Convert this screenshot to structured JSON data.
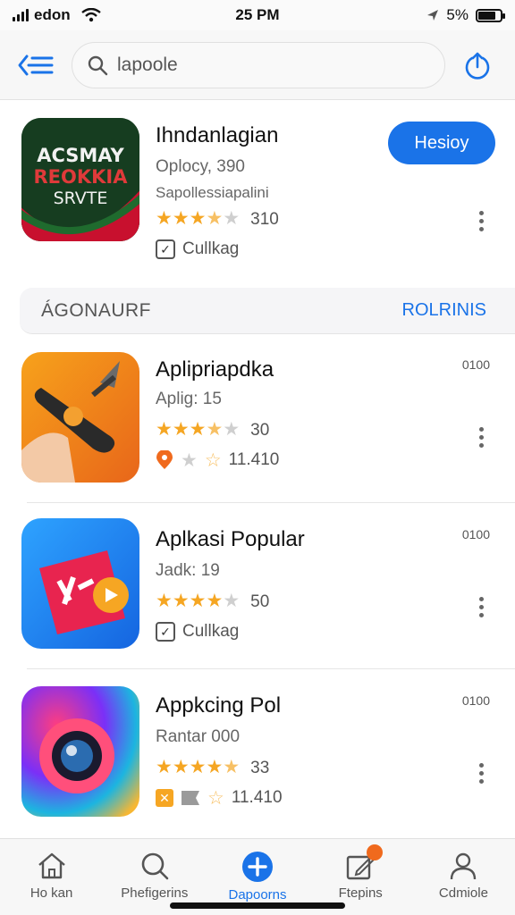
{
  "status_bar": {
    "carrier": "edon",
    "time": "25 PM",
    "battery_pct": "5%",
    "battery_level": 0.8
  },
  "search": {
    "value": "lapoole"
  },
  "featured": {
    "name": "Ihndanlagian",
    "subtitle": "Oplocy, 390",
    "developer": "Sapollessiapalini",
    "rating_count": "310",
    "stars": 3.5,
    "tag": "Cullkag",
    "install_label": "Hesioy",
    "icon_text": [
      "ACSMAY",
      "REOKKIA",
      "SRVTE"
    ]
  },
  "section": {
    "title": "ÁGONAURF",
    "link": "ROLRINIS"
  },
  "apps": [
    {
      "name": "Aplipriapdka",
      "line": "Aplig: 15",
      "stars": 3.5,
      "rating_count": "30",
      "extra": "11.410",
      "side": "0100",
      "extra_type": "icons"
    },
    {
      "name": "Aplkasi Popular",
      "line": "Jadk: 19",
      "stars": 4,
      "rating_count": "50",
      "extra": "Cullkag",
      "side": "0100",
      "extra_type": "check"
    },
    {
      "name": "Appkcing Pol",
      "line": "Rantar 000",
      "stars": 4.5,
      "rating_count": "33",
      "extra": "11.410",
      "side": "0100",
      "extra_type": "icons"
    }
  ],
  "nav": [
    {
      "label": "Ho kan",
      "icon": "home-icon"
    },
    {
      "label": "Phefigerins",
      "icon": "search-icon"
    },
    {
      "label": "Dapoorns",
      "icon": "plus-icon"
    },
    {
      "label": "Ftepins",
      "icon": "edit-icon"
    },
    {
      "label": "Cdmiole",
      "icon": "profile-icon"
    }
  ],
  "colors": {
    "accent": "#1a73e8",
    "star": "#f5a623",
    "badge": "#f06a1d"
  }
}
